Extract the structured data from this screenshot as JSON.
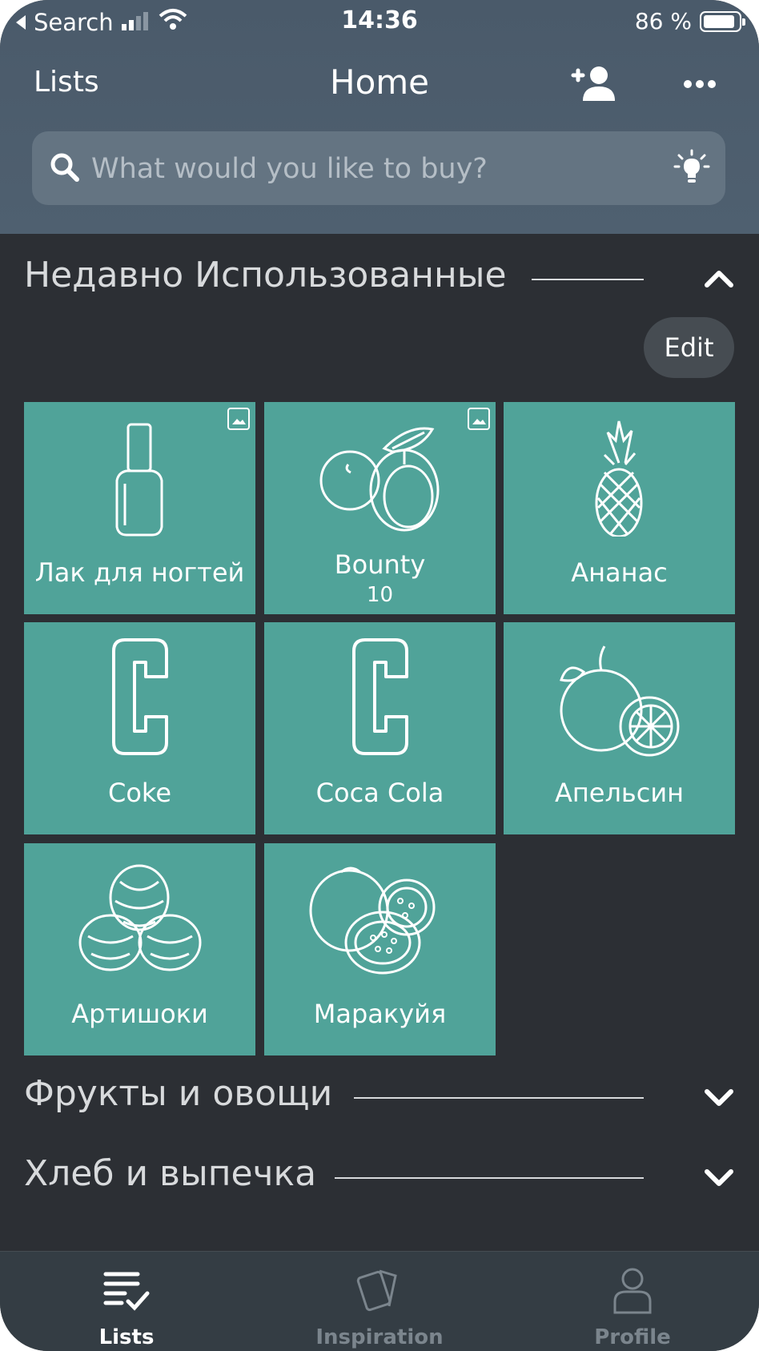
{
  "status_bar": {
    "back_label": "Search",
    "time": "14:36",
    "battery": "86 %"
  },
  "nav": {
    "left": "Lists",
    "title": "Home"
  },
  "search": {
    "placeholder": "What would you like to buy?"
  },
  "recent_section": {
    "title": "Недавно Использованные",
    "edit_label": "Edit",
    "items": [
      {
        "label": "Лак для ногтей",
        "icon": "nail-polish",
        "has_image_badge": true
      },
      {
        "label": "Bounty",
        "quantity": "10",
        "icon": "plum",
        "has_image_badge": true
      },
      {
        "label": "Ананас",
        "icon": "pineapple"
      },
      {
        "label": "Coke",
        "icon": "letter-c"
      },
      {
        "label": "Coca Cola",
        "icon": "letter-c"
      },
      {
        "label": "Апельсин",
        "icon": "orange"
      },
      {
        "label": "Артишоки",
        "icon": "artichoke"
      },
      {
        "label": "Маракуйя",
        "icon": "passion-fruit"
      }
    ]
  },
  "categories": [
    {
      "title": "Фрукты и овощи"
    },
    {
      "title": "Хлеб и выпечка"
    }
  ],
  "tab_bar": {
    "tabs": [
      {
        "label": "Lists",
        "icon": "list-check-icon",
        "active": true
      },
      {
        "label": "Inspiration",
        "icon": "cards-icon",
        "active": false
      },
      {
        "label": "Profile",
        "icon": "person-icon",
        "active": false
      }
    ]
  },
  "colors": {
    "header": "#4f6070",
    "background": "#2c2f34",
    "tile": "#50a399",
    "tabbar": "#343d44"
  }
}
